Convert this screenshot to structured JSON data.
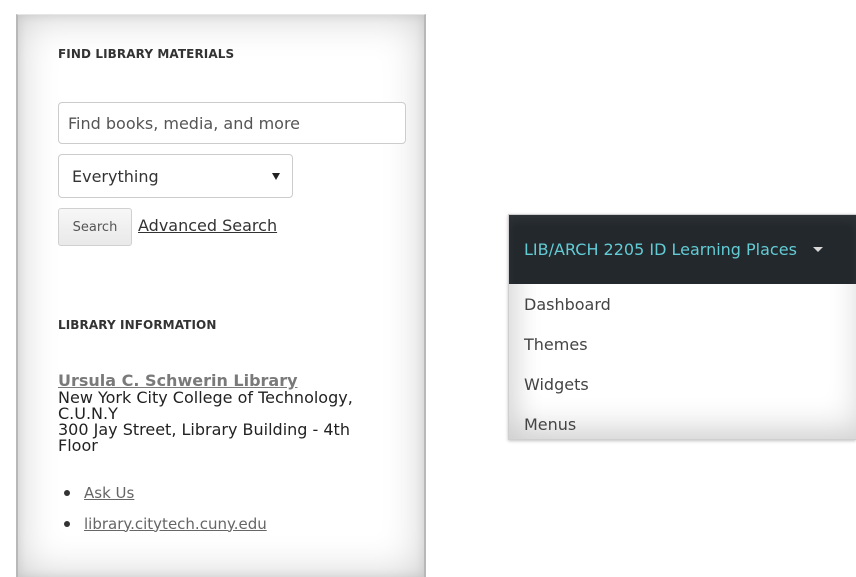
{
  "library_widget": {
    "find_heading": "FIND LIBRARY MATERIALS",
    "search": {
      "placeholder": "Find books, media, and more",
      "value": ""
    },
    "scope_select": {
      "selected": "Everything"
    },
    "search_button": "Search",
    "advanced_search_link": "Advanced Search",
    "info_heading": "LIBRARY INFORMATION",
    "library_name": "Ursula C. Schwerin Library",
    "address_lines": [
      "New York City College of Technology,",
      "C.U.N.Y",
      "300 Jay Street, Library Building - 4th",
      "Floor"
    ],
    "links": [
      "Ask Us",
      "library.citytech.cuny.edu"
    ]
  },
  "admin_menu": {
    "site_title": "LIB/ARCH 2205 ID Learning Places",
    "items": [
      "Dashboard",
      "Themes",
      "Widgets",
      "Menus"
    ],
    "colors": {
      "header_bg": "#23282d",
      "title": "#62cbd4"
    }
  }
}
